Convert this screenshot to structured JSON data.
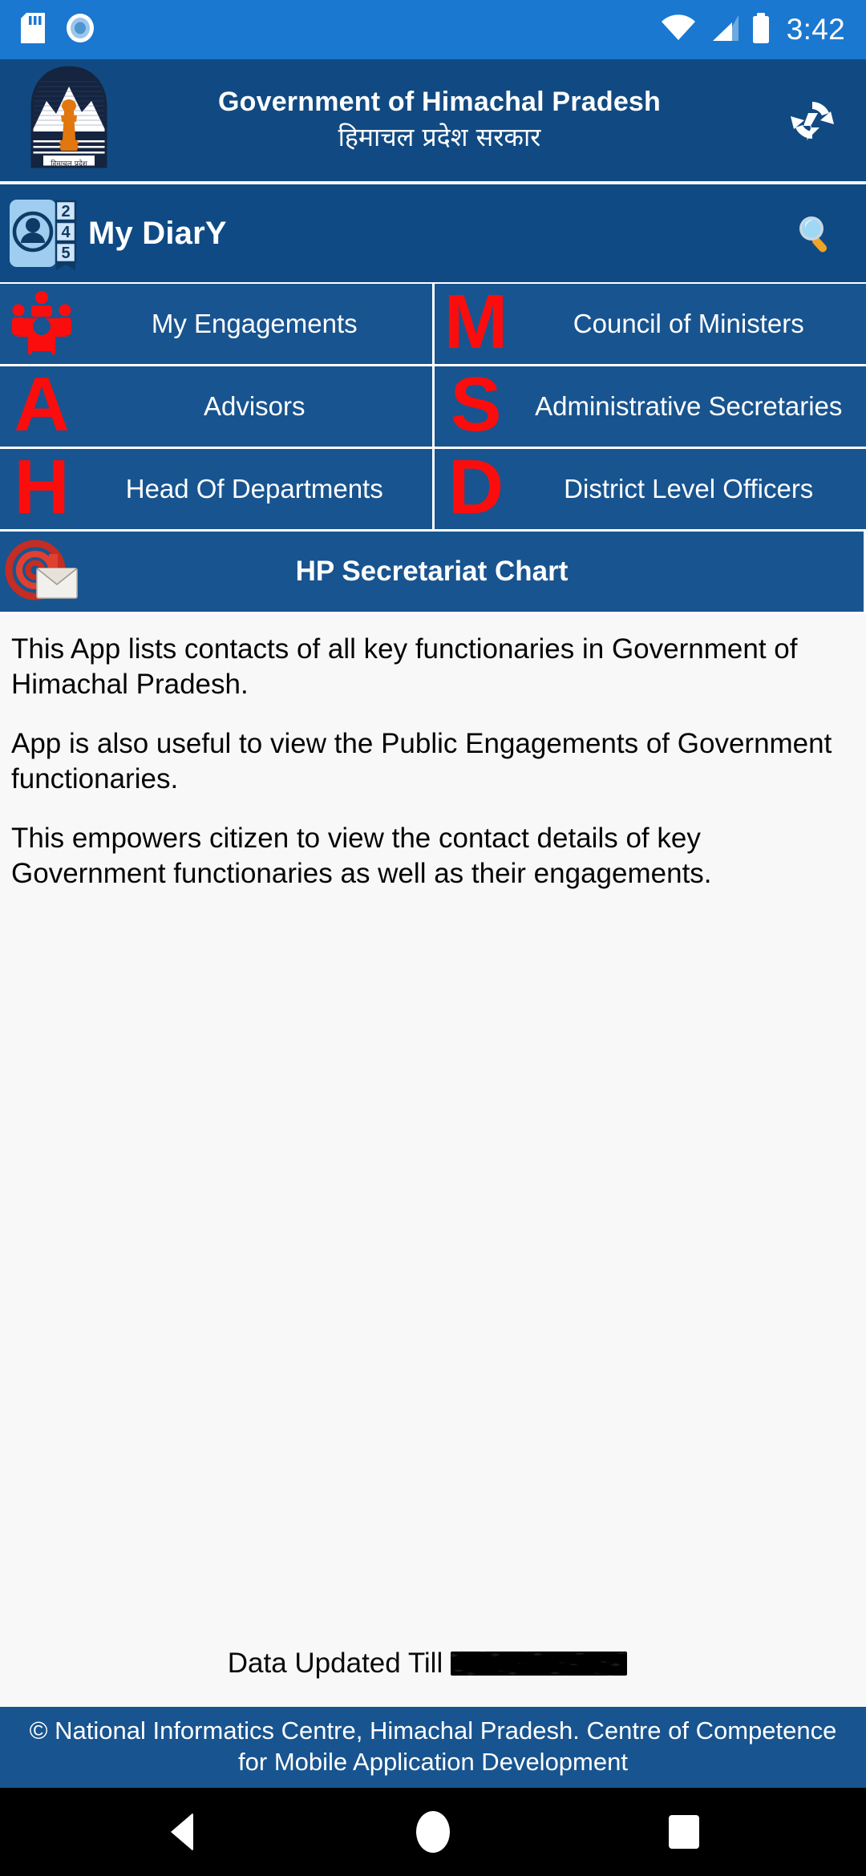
{
  "status_bar": {
    "icons_left": [
      "sd-card-icon",
      "record-circle-icon"
    ],
    "icons_right": [
      "wifi-icon",
      "cellular-signal-icon",
      "battery-icon"
    ],
    "time": "3:42"
  },
  "header": {
    "logo": "himachal-pradesh-emblem",
    "title_en": "Government of Himachal Pradesh",
    "title_hi": "हिमाचल प्रदेश सरकार",
    "sync_icon": "sync-refresh-icon"
  },
  "diary_bar": {
    "icon": "contact-book-icon",
    "icon_tabs": [
      "2",
      "4",
      "5"
    ],
    "label": "My DiarY",
    "search_icon": "search-magnifier-icon"
  },
  "menu": {
    "items": [
      {
        "icon": "meeting-table-icon",
        "icon_letter": "",
        "label": "My Engagements"
      },
      {
        "icon": "letter-m-icon",
        "icon_letter": "M",
        "label": "Council of Ministers"
      },
      {
        "icon": "letter-a-icon",
        "icon_letter": "A",
        "label": "Advisors"
      },
      {
        "icon": "letter-s-icon",
        "icon_letter": "S",
        "label": "Administrative Secretaries"
      },
      {
        "icon": "letter-h-icon",
        "icon_letter": "H",
        "label": "Head Of Departments"
      },
      {
        "icon": "letter-d-icon",
        "icon_letter": "D",
        "label": "District Level Officers"
      }
    ],
    "wide_item": {
      "icon": "at-envelope-icon",
      "label": "HP Secretariat Chart"
    }
  },
  "description": {
    "paragraphs": [
      "This App lists contacts of all key functionaries in Government of Himachal Pradesh.",
      "App is also useful to view the Public Engagements of Government functionaries.",
      "This empowers citizen to view the contact details of key Government functionaries as well as their engagements."
    ]
  },
  "updated": {
    "label": "Data Updated Till",
    "value": "",
    "value_state": "redacted"
  },
  "footer": {
    "text": "© National Informatics Centre, Himachal Pradesh. Centre of Competence for Mobile Application Development"
  },
  "nav_bar": {
    "back": "back-triangle-icon",
    "home": "home-circle-icon",
    "recents": "recents-square-icon"
  },
  "colors": {
    "status_bar": "#1b78d0",
    "header": "#114a82",
    "diary_bar": "#0f4a85",
    "tile": "#18548f",
    "footer": "#18548f",
    "accent_red": "#fc0d0d",
    "content_bg": "#f8f8f8",
    "nav_bar": "#000000"
  }
}
